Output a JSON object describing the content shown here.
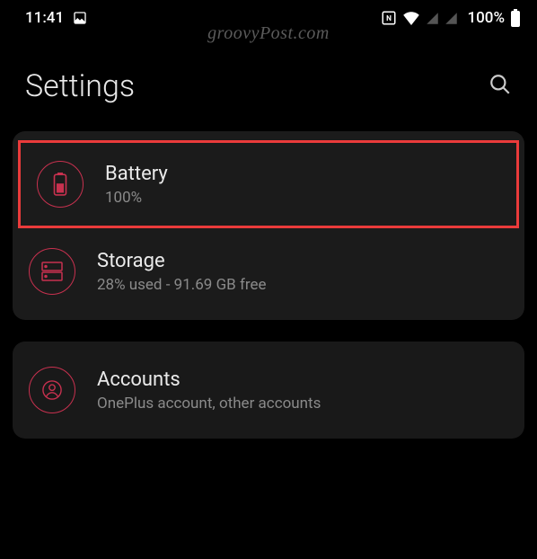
{
  "status_bar": {
    "time": "11:41",
    "battery_pct": "100%"
  },
  "watermark": "groovyPost.com",
  "header": {
    "title": "Settings"
  },
  "rows": {
    "battery": {
      "title": "Battery",
      "subtitle": "100%"
    },
    "storage": {
      "title": "Storage",
      "subtitle": "28% used - 91.69 GB free"
    },
    "accounts": {
      "title": "Accounts",
      "subtitle": "OnePlus account, other accounts"
    }
  }
}
